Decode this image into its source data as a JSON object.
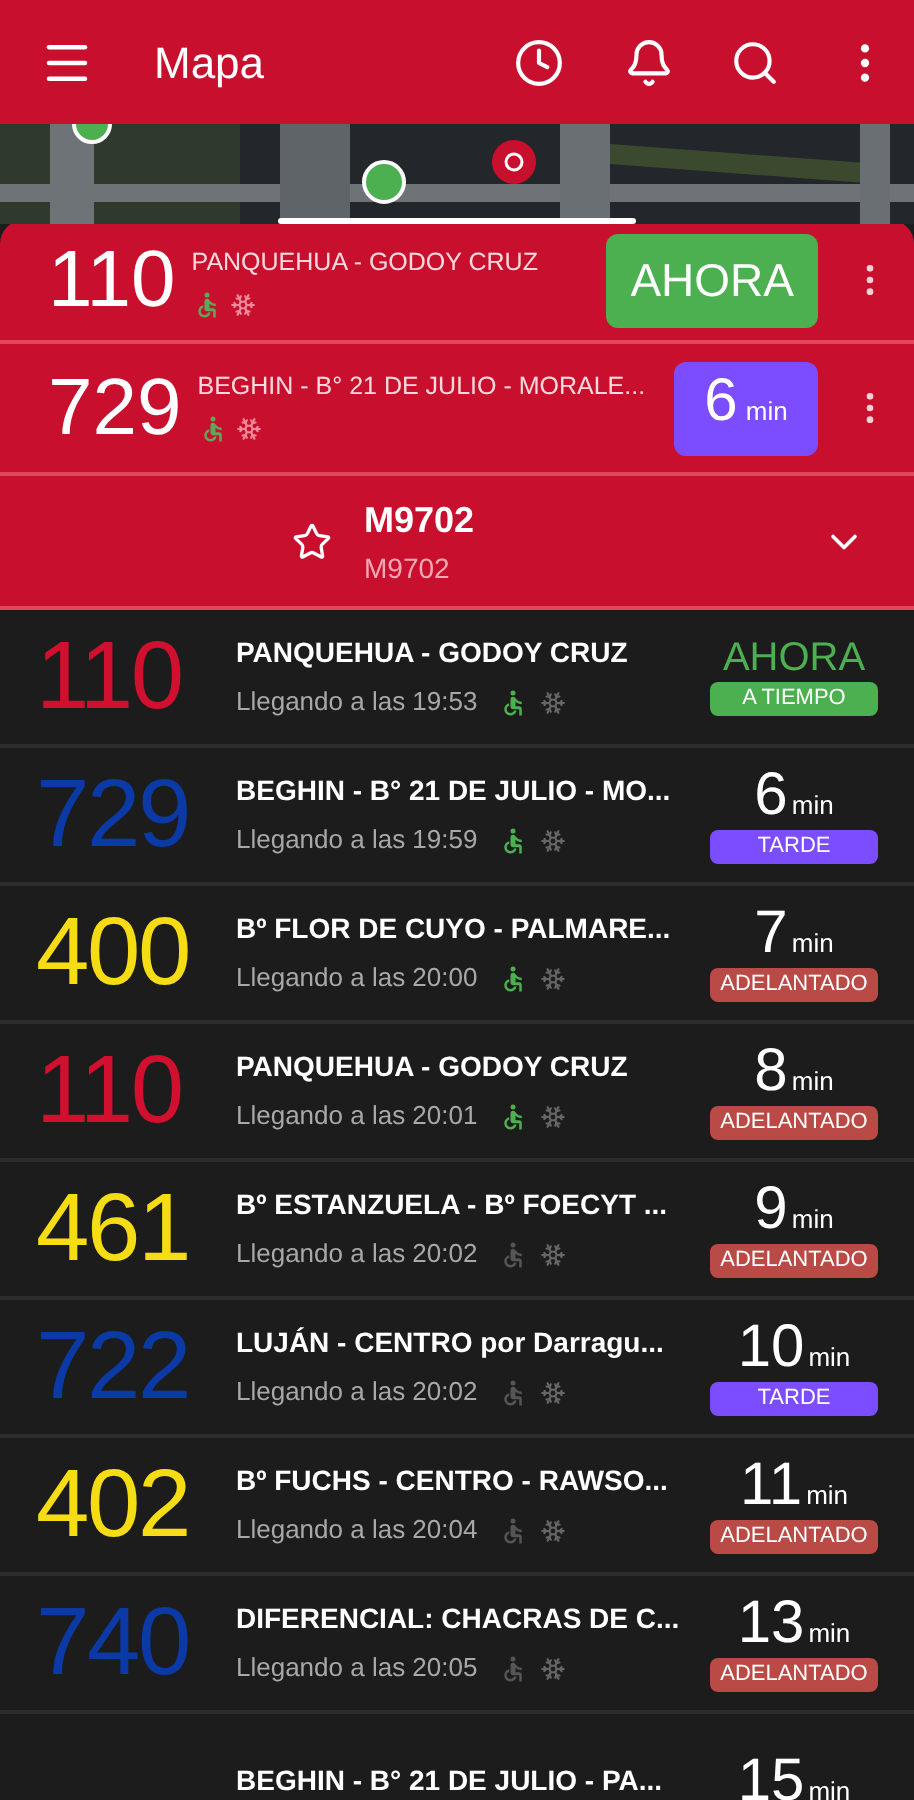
{
  "app_bar": {
    "title": "Mapa"
  },
  "pinned": [
    {
      "route": "110",
      "name": "PANQUEHUA - GODOY CRUZ",
      "accessible": true,
      "arrival": {
        "kind": "now",
        "text": "AHORA",
        "color": "#4caf50"
      }
    },
    {
      "route": "729",
      "name": "BEGHIN - B° 21 DE JULIO - MORALE...",
      "accessible": true,
      "arrival": {
        "kind": "minutes",
        "value": "6",
        "unit": "min",
        "color": "#7c4dff"
      }
    }
  ],
  "stop": {
    "title": "M9702",
    "subtitle": "M9702",
    "favorite": false,
    "expanded": false
  },
  "arrivals": [
    {
      "route": "110",
      "color": "#d0102e",
      "name": "PANQUEHUA - GODOY CRUZ",
      "eta": "Llegando a las 19:53",
      "accessible": true,
      "time": {
        "kind": "now",
        "text": "AHORA"
      },
      "status": {
        "text": "A TIEMPO",
        "color": "#4caf50"
      }
    },
    {
      "route": "729",
      "color": "#0b3aa6",
      "name": "BEGHIN - B° 21 DE JULIO - MO...",
      "eta": "Llegando a las 19:59",
      "accessible": true,
      "time": {
        "kind": "minutes",
        "value": "6",
        "unit": "min"
      },
      "status": {
        "text": "TARDE",
        "color": "#7c4dff"
      }
    },
    {
      "route": "400",
      "color": "#f5dc14",
      "name": "Bº FLOR DE CUYO - PALMARE...",
      "eta": "Llegando a las 20:00",
      "accessible": true,
      "time": {
        "kind": "minutes",
        "value": "7",
        "unit": "min"
      },
      "status": {
        "text": "ADELANTADO",
        "color": "#b94a45"
      }
    },
    {
      "route": "110",
      "color": "#d0102e",
      "name": "PANQUEHUA - GODOY CRUZ",
      "eta": "Llegando a las 20:01",
      "accessible": true,
      "time": {
        "kind": "minutes",
        "value": "8",
        "unit": "min"
      },
      "status": {
        "text": "ADELANTADO",
        "color": "#b94a45"
      }
    },
    {
      "route": "461",
      "color": "#f5dc14",
      "name": "Bº ESTANZUELA - Bº FOECYT ...",
      "eta": "Llegando a las 20:02",
      "accessible": false,
      "time": {
        "kind": "minutes",
        "value": "9",
        "unit": "min"
      },
      "status": {
        "text": "ADELANTADO",
        "color": "#b94a45"
      }
    },
    {
      "route": "722",
      "color": "#0b3aa6",
      "name": "LUJÁN - CENTRO por Darragu...",
      "eta": "Llegando a las 20:02",
      "accessible": false,
      "time": {
        "kind": "minutes",
        "value": "10",
        "unit": "min"
      },
      "status": {
        "text": "TARDE",
        "color": "#7c4dff"
      }
    },
    {
      "route": "402",
      "color": "#f5dc14",
      "name": "Bº FUCHS - CENTRO - RAWSO...",
      "eta": "Llegando a las 20:04",
      "accessible": false,
      "time": {
        "kind": "minutes",
        "value": "11",
        "unit": "min"
      },
      "status": {
        "text": "ADELANTADO",
        "color": "#b94a45"
      }
    },
    {
      "route": "740",
      "color": "#0b3aa6",
      "name": "DIFERENCIAL: CHACRAS DE C...",
      "eta": "Llegando a las 20:05",
      "accessible": false,
      "time": {
        "kind": "minutes",
        "value": "13",
        "unit": "min"
      },
      "status": {
        "text": "ADELANTADO",
        "color": "#b94a45"
      }
    },
    {
      "name": "BEGHIN - B° 21 DE JULIO - PA...",
      "time": {
        "kind": "minutes",
        "value": "15",
        "unit": "min"
      }
    }
  ]
}
